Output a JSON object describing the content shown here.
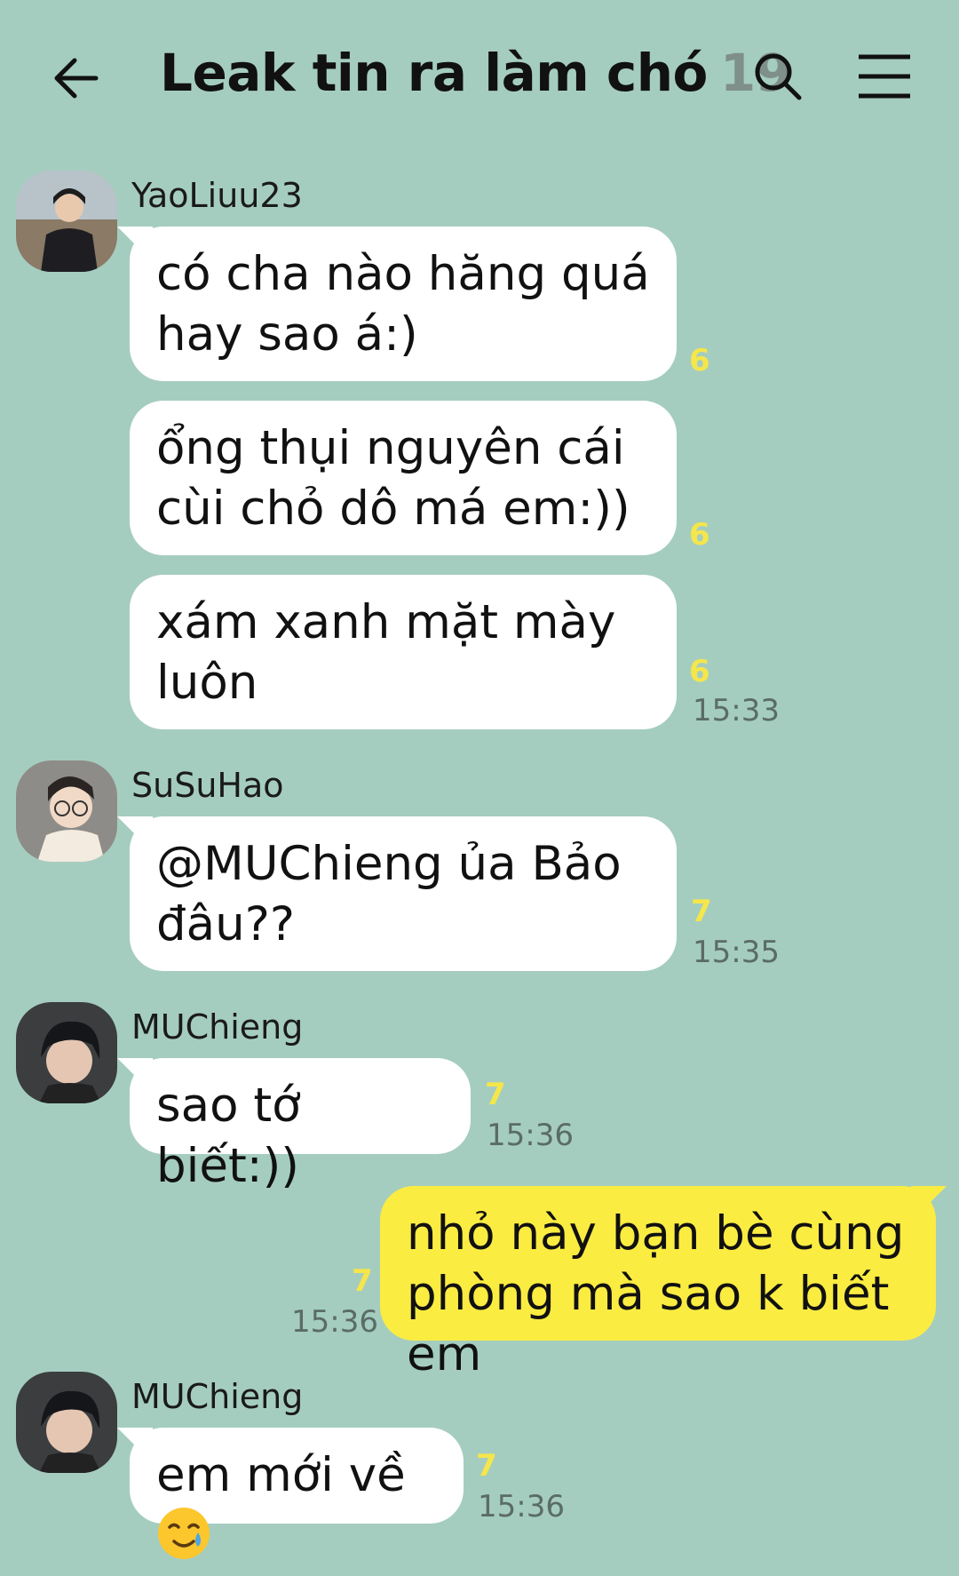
{
  "header": {
    "title": "Leak tin ra làm chó",
    "member_count": "19",
    "back_icon": "arrow-left-icon",
    "search_icon": "search-icon",
    "menu_icon": "menu-icon"
  },
  "colors": {
    "background": "#a5cdbf",
    "incoming_bubble": "#ffffff",
    "outgoing_bubble": "#fbec42",
    "unread_count": "#f5e64a"
  },
  "messages": [
    {
      "sender": "YaoLiuu23",
      "bubbles": [
        {
          "lines": [
            "có cha nào hăng quá",
            "hay sao á:)"
          ],
          "read_count": "6"
        },
        {
          "lines": [
            "ổng thụi nguyên cái",
            "cùi chỏ dô má em:))"
          ],
          "read_count": "6"
        },
        {
          "lines": [
            "xám xanh mặt mày",
            "luôn"
          ],
          "read_count": "6",
          "time": "15:33"
        }
      ]
    },
    {
      "sender": "SuSuHao",
      "bubbles": [
        {
          "lines": [
            "@MUChieng ủa Bảo",
            "đâu??"
          ],
          "read_count": "7",
          "time": "15:35"
        }
      ]
    },
    {
      "sender": "MUChieng",
      "bubbles": [
        {
          "lines": [
            "sao tớ biết:))"
          ],
          "read_count": "7",
          "time": "15:36"
        }
      ]
    },
    {
      "sender": "me",
      "bubbles": [
        {
          "lines": [
            "nhỏ này bạn bè cùng",
            "phòng mà sao k biết em"
          ],
          "read_count": "7",
          "time": "15:36"
        }
      ]
    },
    {
      "sender": "MUChieng",
      "bubbles": [
        {
          "lines": [
            "em mới về"
          ],
          "emoji": "smiling-face-with-tear-icon",
          "read_count": "7",
          "time": "15:36"
        }
      ]
    }
  ]
}
